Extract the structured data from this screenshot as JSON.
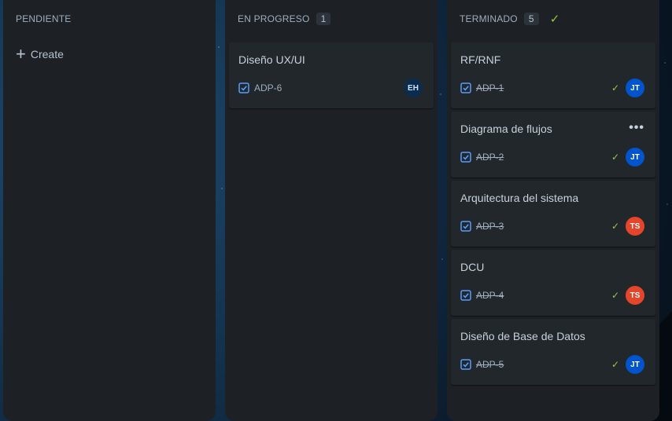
{
  "columns": {
    "pendiente": {
      "title": "PENDIENTE",
      "create_label": "Create"
    },
    "progreso": {
      "title": "EN PROGRESO",
      "count": "1",
      "cards": [
        {
          "title": "Diseño UX/UI",
          "key": "ADP-6",
          "assignee": "EH",
          "assignee_color": "#0c2c4d",
          "assignee_text_color": "#cce0ff"
        }
      ]
    },
    "terminado": {
      "title": "TERMINADO",
      "count": "5",
      "done_icon": "check-icon",
      "cards": [
        {
          "title": "RF/RNF",
          "key": "ADP-1",
          "assignee": "JT",
          "assignee_color": "#0055cc"
        },
        {
          "title": "Diagrama de flujos",
          "key": "ADP-2",
          "assignee": "JT",
          "assignee_color": "#0055cc",
          "more": "•••"
        },
        {
          "title": "Arquitectura del sistema",
          "key": "ADP-3",
          "assignee": "TS",
          "assignee_color": "#e5452a"
        },
        {
          "title": "DCU",
          "key": "ADP-4",
          "assignee": "TS",
          "assignee_color": "#e5452a"
        },
        {
          "title": "Diseño de Base de Datos",
          "key": "ADP-5",
          "assignee": "JT",
          "assignee_color": "#0055cc"
        }
      ]
    }
  },
  "colors": {
    "column_bg": "#1d2125",
    "card_bg": "#22272b",
    "done_green": "#94c748",
    "task_blue": "#579dff"
  }
}
